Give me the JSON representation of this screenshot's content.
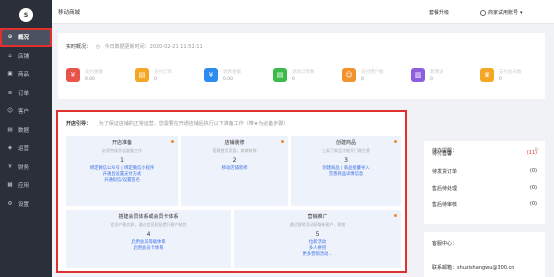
{
  "app": {
    "title": "移动商城"
  },
  "topbar": {
    "upgrade": "套餐升级",
    "user": "商家试用账号"
  },
  "sidebar": {
    "logo": "S",
    "items": [
      {
        "label": "概况",
        "icon": "dashboard-icon",
        "glyph": "⊙"
      },
      {
        "label": "店铺",
        "icon": "store-icon",
        "glyph": "⌂"
      },
      {
        "label": "商品",
        "icon": "goods-icon",
        "glyph": "▣"
      },
      {
        "label": "订单",
        "icon": "order-icon",
        "glyph": "≡"
      },
      {
        "label": "客户",
        "icon": "customer-icon",
        "glyph": "☺"
      },
      {
        "label": "数据",
        "icon": "data-icon",
        "glyph": "▤"
      },
      {
        "label": "运营",
        "icon": "operation-icon",
        "glyph": "◈"
      },
      {
        "label": "财务",
        "icon": "finance-icon",
        "glyph": "¥"
      },
      {
        "label": "应用",
        "icon": "apps-icon",
        "glyph": "▦"
      },
      {
        "label": "设置",
        "icon": "settings-icon",
        "glyph": "⚙"
      }
    ]
  },
  "overview": {
    "title": "实时概况：",
    "subtitle": "今日数据更新时间：2020-02-21 11:52:11",
    "stats": [
      {
        "label": "支付金额",
        "value": "0.00",
        "color": "#e8534a",
        "glyph": "¥",
        "icon": "payment-icon"
      },
      {
        "label": "支付订单",
        "value": "0",
        "color": "#f5a623",
        "glyph": "▤",
        "icon": "paid-order-icon"
      },
      {
        "label": "退款金额",
        "value": "0.00",
        "color": "#2d8cf0",
        "glyph": "¥",
        "icon": "refund-icon"
      },
      {
        "label": "退款订单数",
        "value": "0",
        "color": "#3cba4a",
        "glyph": "▤",
        "icon": "refund-order-icon"
      },
      {
        "label": "支付用户数",
        "value": "0",
        "color": "#f2922e",
        "glyph": "☺",
        "icon": "paying-user-icon"
      },
      {
        "label": "新增访",
        "value": "0",
        "color": "#8e5de0",
        "glyph": "▥",
        "icon": "new-visit-icon"
      },
      {
        "label": "支付会员数",
        "value": "0",
        "color": "#f5a623",
        "glyph": "♛",
        "icon": "member-icon"
      }
    ]
  },
  "guide": {
    "title": "开店引导：",
    "subtitle": "为了保证店铺的正常运营，您需要在开通店铺后执行以下准备工作（带★为必备步骤）",
    "cards": [
      {
        "title": "开店准备",
        "sub": "必须完成开店准备工作",
        "num": "1",
        "links": [
          "绑定微信公众号 | 绑定微信小程序",
          "开通且设置支付方式",
          "开通短信/设置签名"
        ]
      },
      {
        "title": "店铺装修",
        "sub": "搭建首页页面，商城装饰",
        "num": "2",
        "links": [
          "移动店铺装修"
        ]
      },
      {
        "title": "创建商品",
        "sub": "上架了商品才能开门做生意",
        "num": "3",
        "links": [
          "创建商品 | 商品批量导入",
          "完善商品详情信息"
        ]
      },
      {
        "title": "搭建会员体系或会员卡体系",
        "sub": "会员产能优质，通过会员权益提升客户粘性",
        "num": "4",
        "links": [
          "启用会员等级体系",
          "启用会员卡体系"
        ]
      },
      {
        "title": "营销推广",
        "sub": "通过营销活动获取新客户，裂变",
        "num": "5",
        "links": [
          "拉新活动",
          "多人拼团",
          "更多营销活动..."
        ]
      }
    ]
  },
  "todo": {
    "title": "待办提醒：",
    "items": [
      {
        "label": "待付售馨",
        "count": "(11)"
      },
      {
        "label": "待发货订单",
        "count": "(0)"
      },
      {
        "label": "售后待处理",
        "count": "(0)"
      },
      {
        "label": "售后待审核",
        "count": "(0)"
      }
    ]
  },
  "help": {
    "title": "客服中心：",
    "email": "联系邮箱：shuzishangwu@300.cn"
  }
}
